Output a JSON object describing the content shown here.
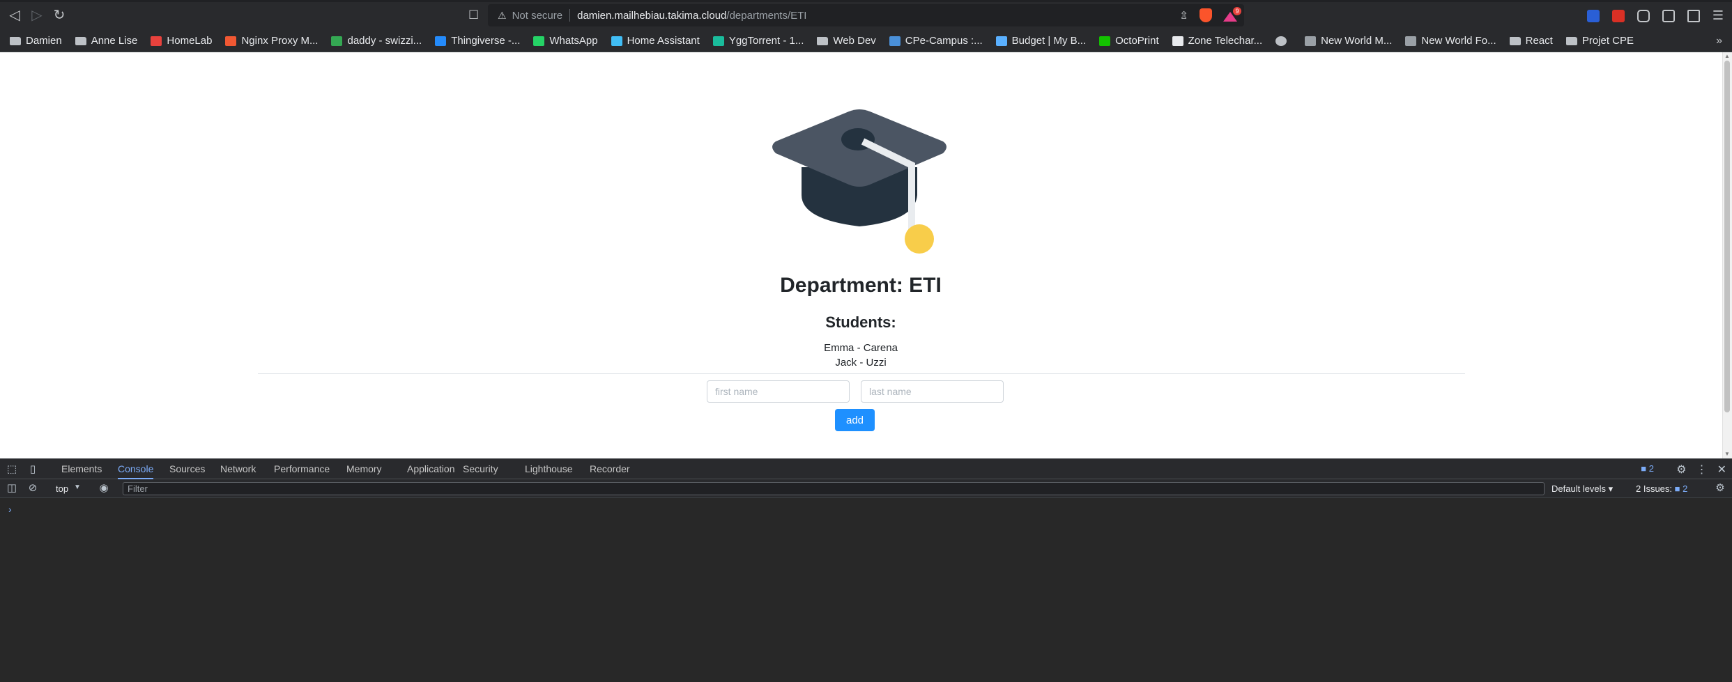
{
  "browser": {
    "omnibox": {
      "security_label": "Not secure",
      "host": "damien.mailhebiau.takima.cloud",
      "path": "/departments/ETI"
    },
    "rewards_badge": "9",
    "bookmarks": [
      {
        "label": "Damien",
        "icon": "folder-icon",
        "color": "#bdc1c6"
      },
      {
        "label": "Anne Lise",
        "icon": "folder-icon",
        "color": "#bdc1c6"
      },
      {
        "label": "HomeLab",
        "icon": "homelab-icon",
        "color": "#e8423d"
      },
      {
        "label": "Nginx Proxy M...",
        "icon": "nginx-icon",
        "color": "#f15833"
      },
      {
        "label": "daddy - swizzi...",
        "icon": "check-icon",
        "color": "#34a853"
      },
      {
        "label": "Thingiverse -...",
        "icon": "thingiverse-icon",
        "color": "#248bfb"
      },
      {
        "label": "WhatsApp",
        "icon": "whatsapp-icon",
        "color": "#25d366"
      },
      {
        "label": "Home Assistant",
        "icon": "home-assistant-icon",
        "color": "#41bdf5"
      },
      {
        "label": "YggTorrent - 1...",
        "icon": "ygg-icon",
        "color": "#1abc9c"
      },
      {
        "label": "Web Dev",
        "icon": "folder-icon",
        "color": "#bdc1c6"
      },
      {
        "label": "CPe-Campus :...",
        "icon": "cpe-icon",
        "color": "#4a90d9"
      },
      {
        "label": "Budget | My B...",
        "icon": "budget-icon",
        "color": "#5ab0ff"
      },
      {
        "label": "OctoPrint",
        "icon": "octoprint-icon",
        "color": "#13c100"
      },
      {
        "label": "Zone Telechar...",
        "icon": "zone-icon",
        "color": "#e8eaed"
      },
      {
        "label": "",
        "icon": "globe-icon",
        "color": "#bdc1c6"
      },
      {
        "label": "New World M...",
        "icon": "newworld-icon",
        "color": "#9aa0a6"
      },
      {
        "label": "New World Fo...",
        "icon": "newworld-icon",
        "color": "#9aa0a6"
      },
      {
        "label": "React",
        "icon": "folder-icon",
        "color": "#bdc1c6"
      },
      {
        "label": "Projet CPE",
        "icon": "folder-icon",
        "color": "#bdc1c6"
      }
    ]
  },
  "page": {
    "title": "Department: ETI",
    "students_heading": "Students:",
    "students": [
      "Emma - Carena",
      "Jack - Uzzi"
    ],
    "form": {
      "first_name_placeholder": "first name",
      "last_name_placeholder": "last name",
      "add_label": "add"
    },
    "colors": {
      "button": "#1e90ff",
      "cap_top": "#4b5563",
      "cap_base": "#24323f",
      "tassel": "#f8cd4a"
    }
  },
  "devtools": {
    "tabs": [
      "Elements",
      "Console",
      "Sources",
      "Network",
      "Performance",
      "Memory",
      "Application",
      "Security",
      "Lighthouse",
      "Recorder"
    ],
    "active_tab": "Console",
    "issues_badge": "2",
    "context": "top",
    "filter_placeholder": "Filter",
    "levels": "Default levels",
    "issues_label": "2 Issues:",
    "issues_count": "2",
    "prompt": "›"
  }
}
